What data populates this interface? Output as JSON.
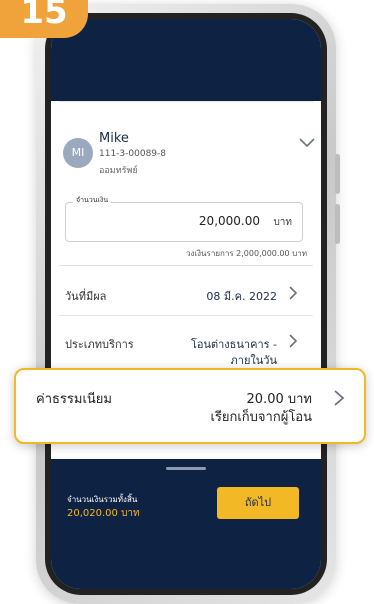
{
  "step_badge": "15",
  "account": {
    "avatar_initials": "MI",
    "name": "Mike",
    "number": "111-3-00089-8",
    "type": "ออมทรัพย์"
  },
  "amount": {
    "label": "จำนวนเงิน",
    "value": "20,000.00",
    "unit": "บาท",
    "limit_text": "วงเงินรายการ 2,000,000.00 บาท"
  },
  "effective_date": {
    "label": "วันที่มีผล",
    "value": "08 มี.ค. 2022"
  },
  "service_type": {
    "label": "ประเภทบริการ",
    "value_line1": "โอนต่างธนาคาร -",
    "value_line2": "ภายในวัน"
  },
  "fee": {
    "label": "ค่าธรรมเนียม",
    "amount": "20.00 บาท",
    "payer": "เรียกเก็บจากผู้โอน"
  },
  "footer": {
    "total_label": "จำนวนเงินรวมทั้งสิ้น",
    "total_value": "20,020.00 บาท",
    "next_label": "ถัดไป"
  },
  "colors": {
    "navy": "#0e2344",
    "accent_yellow": "#f3b825",
    "badge_orange": "#f0a33a"
  },
  "icons": [
    "chevron-down-icon",
    "chevron-right-icon"
  ]
}
